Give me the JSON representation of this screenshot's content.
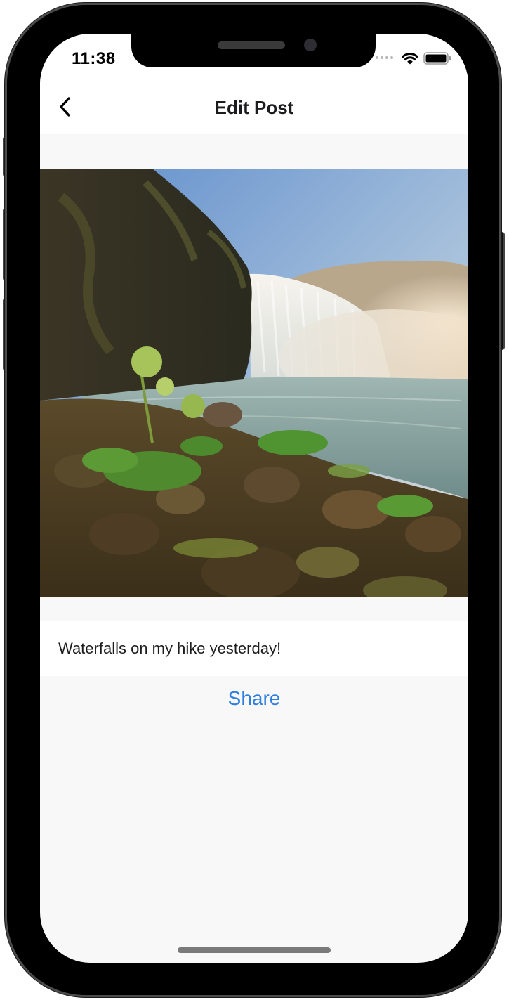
{
  "status_bar": {
    "time": "11:38",
    "wifi_icon": "wifi-icon",
    "battery_icon": "battery-icon"
  },
  "nav": {
    "title": "Edit Post",
    "back_icon": "chevron-left-icon"
  },
  "post": {
    "caption": "Waterfalls on my hike yesterday!",
    "share_label": "Share"
  },
  "colors": {
    "accent": "#2f7fe0",
    "screen_background": "#f8f8f8",
    "title_text": "#1c1c1e"
  }
}
